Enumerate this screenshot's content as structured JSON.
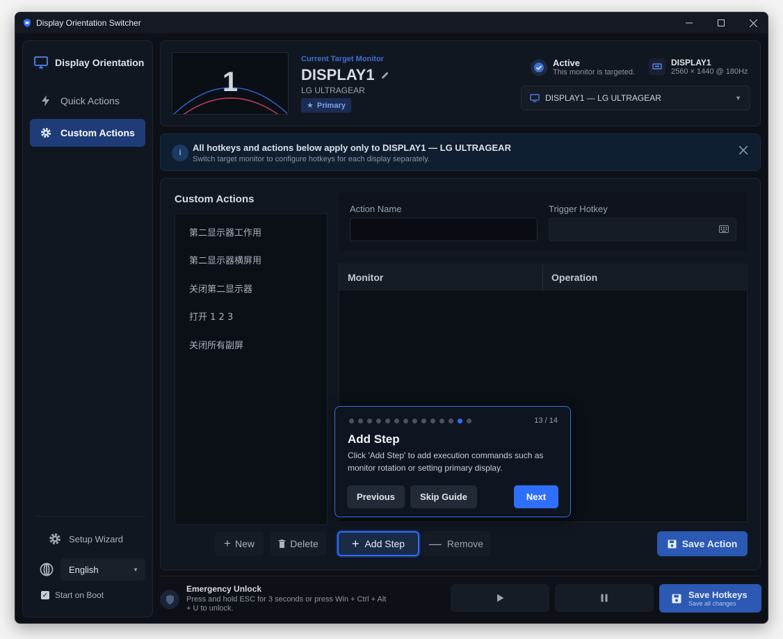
{
  "window": {
    "title": "Display Orientation Switcher"
  },
  "sidebar": {
    "heading": "Display Orientation",
    "items": [
      {
        "label": "Quick Actions",
        "icon": "lightning-icon",
        "active": false
      },
      {
        "label": "Custom Actions",
        "icon": "gear-icon",
        "active": true
      }
    ],
    "setup_wizard": "Setup Wizard",
    "language": "English",
    "start_on_boot": "Start on Boot",
    "start_on_boot_checked": true
  },
  "header": {
    "monitor_number": "1",
    "target_label": "Current Target Monitor",
    "display_name": "DISPLAY1",
    "model": "LG ULTRAGEAR",
    "primary_badge": "Primary",
    "status_title": "Active",
    "status_sub": "This monitor is targeted.",
    "display_id": "DISPLAY1",
    "resolution": "2560 × 1440 @ 180Hz",
    "monitor_select": "DISPLAY1 — LG ULTRAGEAR"
  },
  "banner": {
    "title": "All hotkeys and actions below apply only to DISPLAY1 — LG ULTRAGEAR",
    "subtitle": "Switch target monitor to configure hotkeys for each display separately."
  },
  "custom_actions": {
    "title": "Custom Actions",
    "list": [
      "第二显示器工作用",
      "第二显示器横屏用",
      "关闭第二显示器",
      "打开 1 2 3",
      "关闭所有副屏"
    ],
    "new_label": "New",
    "delete_label": "Delete",
    "action_name_label": "Action Name",
    "action_name_value": "",
    "trigger_hotkey_label": "Trigger Hotkey",
    "trigger_hotkey_value": "",
    "table_headers": [
      "Monitor",
      "Operation"
    ],
    "add_step_label": "Add Step",
    "remove_label": "Remove",
    "save_action_label": "Save Action"
  },
  "guide": {
    "step_count": "13 / 14",
    "current_step": 13,
    "total_steps": 14,
    "title": "Add Step",
    "body": "Click 'Add Step' to add execution commands such as monitor rotation or setting primary display.",
    "previous": "Previous",
    "skip": "Skip Guide",
    "next": "Next"
  },
  "footer": {
    "emergency_title": "Emergency Unlock",
    "emergency_text": "Press and hold ESC for 3 seconds or press Win + Ctrl + Alt + U to unlock.",
    "save_hotkeys": "Save Hotkeys",
    "save_hotkeys_sub": "Save all changes"
  },
  "colors": {
    "accent": "#2f6fff",
    "primary_button": "#2b59b3",
    "active_nav": "#1f3c78",
    "window_bg": "#0d1117"
  }
}
